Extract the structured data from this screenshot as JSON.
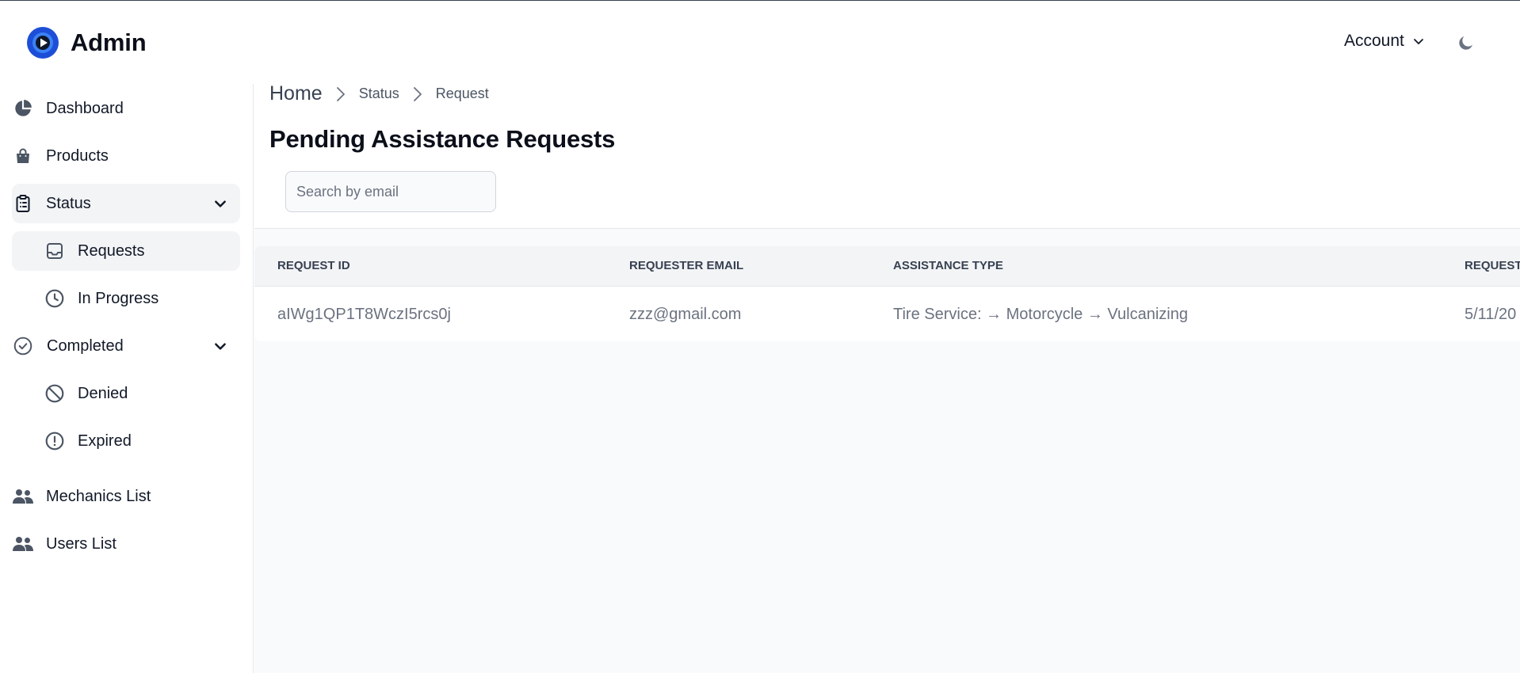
{
  "app": {
    "title": "Admin"
  },
  "header": {
    "account_label": "Account"
  },
  "colors": {
    "accent": "#2563eb",
    "sidebar_active": "#f3f4f6",
    "table_header": "#f3f4f6",
    "muted_text": "#6b7280"
  },
  "sidebar": {
    "items": [
      {
        "label": "Dashboard",
        "icon": "pie-chart-icon"
      },
      {
        "label": "Products",
        "icon": "shopping-bag-icon"
      },
      {
        "label": "Status",
        "icon": "clipboard-list-icon",
        "expanded": true
      },
      {
        "label": "Requests",
        "icon": "inbox-icon",
        "active": true
      },
      {
        "label": "In Progress",
        "icon": "clock-icon"
      },
      {
        "label": "Completed",
        "icon": "check-circle-icon",
        "expanded": true
      },
      {
        "label": "Denied",
        "icon": "ban-icon"
      },
      {
        "label": "Expired",
        "icon": "exclamation-circle-icon"
      },
      {
        "label": "Mechanics List",
        "icon": "users-icon"
      },
      {
        "label": "Users List",
        "icon": "users-icon"
      }
    ]
  },
  "breadcrumb": {
    "home": "Home",
    "level1": "Status",
    "level2": "Request"
  },
  "main": {
    "title": "Pending Assistance Requests",
    "search": {
      "placeholder": "Search by email",
      "value": ""
    }
  },
  "table": {
    "columns": [
      "Request ID",
      "Requester Email",
      "Assistance Type",
      "Request"
    ],
    "rows": [
      {
        "id": "aIWg1QP1T8WczI5rcs0j",
        "email": "zzz@gmail.com",
        "type": "Tire Service: → Motorcycle → Vulcanizing",
        "date": "5/11/20"
      }
    ]
  }
}
